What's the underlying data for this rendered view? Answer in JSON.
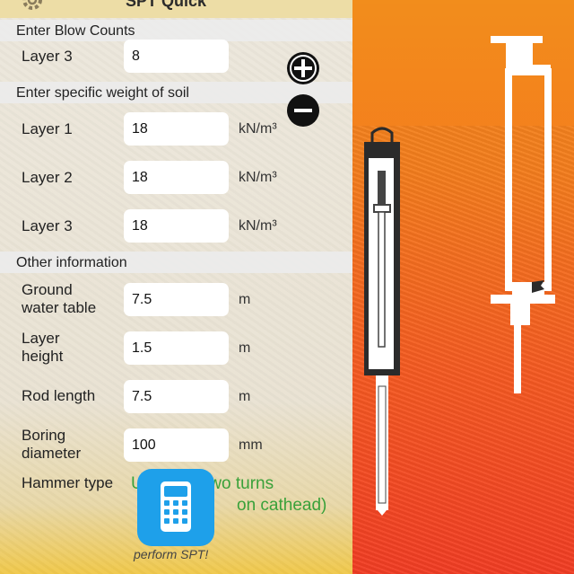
{
  "header": {
    "title": "SPT Quick",
    "settings_icon": "gear-icon"
  },
  "sections": {
    "blow_counts": "Enter Blow Counts",
    "specific_weight": "Enter specific weight of soil",
    "other": "Other information"
  },
  "blow_counts": {
    "layer3_label": "Layer 3",
    "layer3_value": "8"
  },
  "specific_weight": {
    "layers": [
      {
        "label": "Layer 1",
        "value": "18",
        "unit": "kN/m³"
      },
      {
        "label": "Layer 2",
        "value": "18",
        "unit": "kN/m³"
      },
      {
        "label": "Layer 3",
        "value": "18",
        "unit": "kN/m³"
      }
    ]
  },
  "other": {
    "ground_water_table": {
      "label1": "Ground",
      "label2": "water table",
      "value": "7.5",
      "unit": "m"
    },
    "layer_height": {
      "label1": "Layer",
      "label2": "height",
      "value": "1.5",
      "unit": "m"
    },
    "rod_length": {
      "label": "Rod length",
      "value": "7.5",
      "unit": "m"
    },
    "boring_diameter": {
      "label1": "Boring",
      "label2": "diameter",
      "value": "100",
      "unit": "mm"
    },
    "hammer_type": {
      "label": "Hammer type",
      "value_line1": "U... ety - Two turns",
      "value_line2": "on cathead)"
    }
  },
  "controls": {
    "add_layer_icon": "plus-circle-icon",
    "remove_layer_icon": "minus-circle-icon"
  },
  "perform": {
    "label": "perform SPT!",
    "icon": "calculator-icon"
  },
  "colors": {
    "accent_green": "#3aa13a",
    "button_blue": "#1ea0ea",
    "orange": "#f28a1e",
    "red_orange": "#f23d24"
  }
}
